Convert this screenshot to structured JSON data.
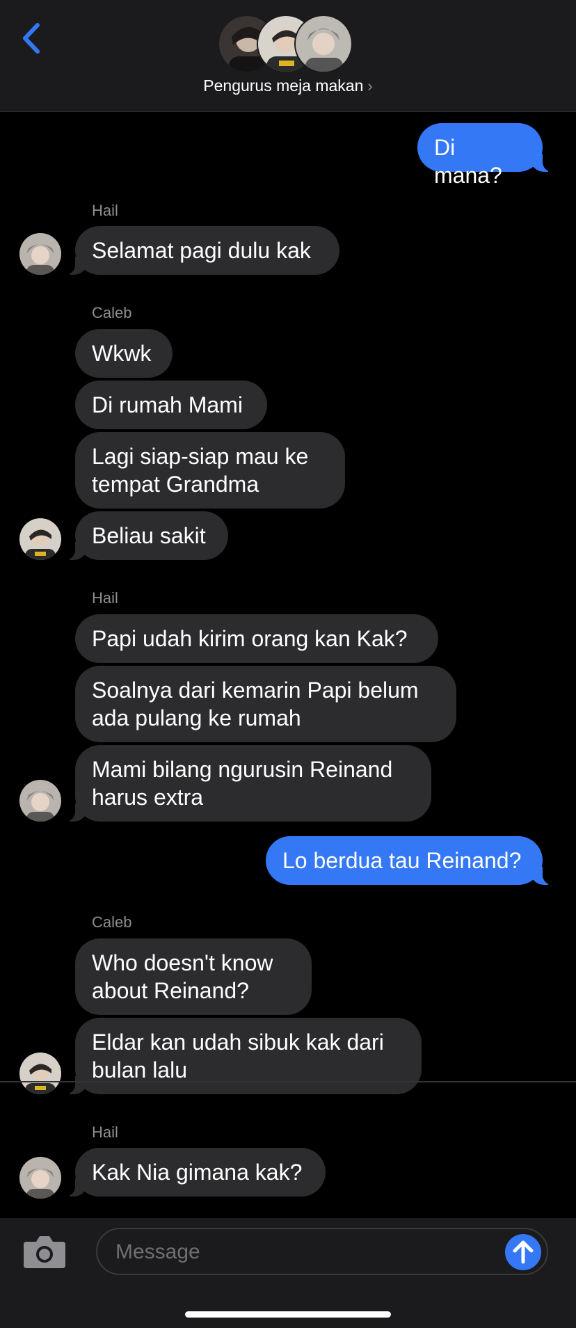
{
  "header": {
    "group_name": "Pengurus meja makan",
    "back_icon": "chevron-left-icon",
    "chevron": "›"
  },
  "messages": [
    {
      "type": "outgoing",
      "text": "Di mana?"
    },
    {
      "type": "sender",
      "text": "Hail"
    },
    {
      "type": "incoming",
      "text": "Selamat pagi dulu kak"
    },
    {
      "type": "sender",
      "text": "Caleb"
    },
    {
      "type": "incoming",
      "text": "Wkwk"
    },
    {
      "type": "incoming",
      "text": "Di rumah Mami"
    },
    {
      "type": "incoming",
      "text": "Lagi siap-siap mau ke tempat Grandma"
    },
    {
      "type": "incoming",
      "text": "Beliau sakit"
    },
    {
      "type": "sender",
      "text": "Hail"
    },
    {
      "type": "incoming",
      "text": "Papi udah kirim orang kan Kak?"
    },
    {
      "type": "incoming",
      "text": "Soalnya dari kemarin Papi belum ada pulang ke rumah"
    },
    {
      "type": "incoming",
      "text": "Mami bilang ngurusin Reinand harus extra"
    },
    {
      "type": "outgoing",
      "text": "Lo berdua tau Reinand?"
    },
    {
      "type": "sender",
      "text": "Caleb"
    },
    {
      "type": "incoming",
      "text": "Who doesn't know about Reinand?"
    },
    {
      "type": "incoming",
      "text": "Eldar kan udah sibuk kak dari bulan lalu"
    },
    {
      "type": "sender",
      "text": "Hail"
    },
    {
      "type": "incoming",
      "text": "Kak Nia gimana kak?"
    }
  ],
  "composer": {
    "placeholder": "Message",
    "camera_icon": "camera-icon",
    "send_icon": "arrow-up-icon"
  },
  "colors": {
    "accent": "#3478f6",
    "incoming_bubble": "#2c2c2e",
    "background": "#000000",
    "header_bg": "#1b1b1d",
    "secondary_text": "#8e8e93"
  }
}
